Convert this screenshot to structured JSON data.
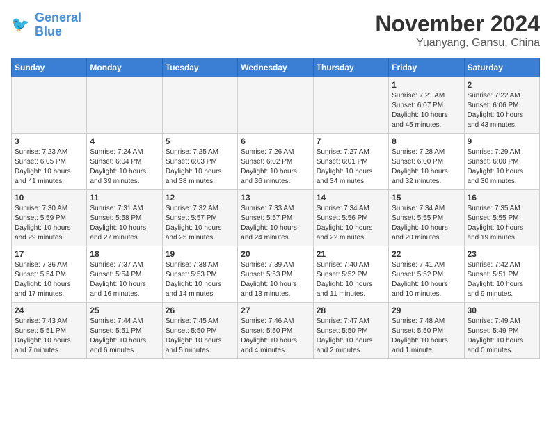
{
  "header": {
    "logo_line1": "General",
    "logo_line2": "Blue",
    "title": "November 2024",
    "subtitle": "Yuanyang, Gansu, China"
  },
  "weekdays": [
    "Sunday",
    "Monday",
    "Tuesday",
    "Wednesday",
    "Thursday",
    "Friday",
    "Saturday"
  ],
  "weeks": [
    [
      {
        "day": "",
        "info": ""
      },
      {
        "day": "",
        "info": ""
      },
      {
        "day": "",
        "info": ""
      },
      {
        "day": "",
        "info": ""
      },
      {
        "day": "",
        "info": ""
      },
      {
        "day": "1",
        "info": "Sunrise: 7:21 AM\nSunset: 6:07 PM\nDaylight: 10 hours\nand 45 minutes."
      },
      {
        "day": "2",
        "info": "Sunrise: 7:22 AM\nSunset: 6:06 PM\nDaylight: 10 hours\nand 43 minutes."
      }
    ],
    [
      {
        "day": "3",
        "info": "Sunrise: 7:23 AM\nSunset: 6:05 PM\nDaylight: 10 hours\nand 41 minutes."
      },
      {
        "day": "4",
        "info": "Sunrise: 7:24 AM\nSunset: 6:04 PM\nDaylight: 10 hours\nand 39 minutes."
      },
      {
        "day": "5",
        "info": "Sunrise: 7:25 AM\nSunset: 6:03 PM\nDaylight: 10 hours\nand 38 minutes."
      },
      {
        "day": "6",
        "info": "Sunrise: 7:26 AM\nSunset: 6:02 PM\nDaylight: 10 hours\nand 36 minutes."
      },
      {
        "day": "7",
        "info": "Sunrise: 7:27 AM\nSunset: 6:01 PM\nDaylight: 10 hours\nand 34 minutes."
      },
      {
        "day": "8",
        "info": "Sunrise: 7:28 AM\nSunset: 6:00 PM\nDaylight: 10 hours\nand 32 minutes."
      },
      {
        "day": "9",
        "info": "Sunrise: 7:29 AM\nSunset: 6:00 PM\nDaylight: 10 hours\nand 30 minutes."
      }
    ],
    [
      {
        "day": "10",
        "info": "Sunrise: 7:30 AM\nSunset: 5:59 PM\nDaylight: 10 hours\nand 29 minutes."
      },
      {
        "day": "11",
        "info": "Sunrise: 7:31 AM\nSunset: 5:58 PM\nDaylight: 10 hours\nand 27 minutes."
      },
      {
        "day": "12",
        "info": "Sunrise: 7:32 AM\nSunset: 5:57 PM\nDaylight: 10 hours\nand 25 minutes."
      },
      {
        "day": "13",
        "info": "Sunrise: 7:33 AM\nSunset: 5:57 PM\nDaylight: 10 hours\nand 24 minutes."
      },
      {
        "day": "14",
        "info": "Sunrise: 7:34 AM\nSunset: 5:56 PM\nDaylight: 10 hours\nand 22 minutes."
      },
      {
        "day": "15",
        "info": "Sunrise: 7:34 AM\nSunset: 5:55 PM\nDaylight: 10 hours\nand 20 minutes."
      },
      {
        "day": "16",
        "info": "Sunrise: 7:35 AM\nSunset: 5:55 PM\nDaylight: 10 hours\nand 19 minutes."
      }
    ],
    [
      {
        "day": "17",
        "info": "Sunrise: 7:36 AM\nSunset: 5:54 PM\nDaylight: 10 hours\nand 17 minutes."
      },
      {
        "day": "18",
        "info": "Sunrise: 7:37 AM\nSunset: 5:54 PM\nDaylight: 10 hours\nand 16 minutes."
      },
      {
        "day": "19",
        "info": "Sunrise: 7:38 AM\nSunset: 5:53 PM\nDaylight: 10 hours\nand 14 minutes."
      },
      {
        "day": "20",
        "info": "Sunrise: 7:39 AM\nSunset: 5:53 PM\nDaylight: 10 hours\nand 13 minutes."
      },
      {
        "day": "21",
        "info": "Sunrise: 7:40 AM\nSunset: 5:52 PM\nDaylight: 10 hours\nand 11 minutes."
      },
      {
        "day": "22",
        "info": "Sunrise: 7:41 AM\nSunset: 5:52 PM\nDaylight: 10 hours\nand 10 minutes."
      },
      {
        "day": "23",
        "info": "Sunrise: 7:42 AM\nSunset: 5:51 PM\nDaylight: 10 hours\nand 9 minutes."
      }
    ],
    [
      {
        "day": "24",
        "info": "Sunrise: 7:43 AM\nSunset: 5:51 PM\nDaylight: 10 hours\nand 7 minutes."
      },
      {
        "day": "25",
        "info": "Sunrise: 7:44 AM\nSunset: 5:51 PM\nDaylight: 10 hours\nand 6 minutes."
      },
      {
        "day": "26",
        "info": "Sunrise: 7:45 AM\nSunset: 5:50 PM\nDaylight: 10 hours\nand 5 minutes."
      },
      {
        "day": "27",
        "info": "Sunrise: 7:46 AM\nSunset: 5:50 PM\nDaylight: 10 hours\nand 4 minutes."
      },
      {
        "day": "28",
        "info": "Sunrise: 7:47 AM\nSunset: 5:50 PM\nDaylight: 10 hours\nand 2 minutes."
      },
      {
        "day": "29",
        "info": "Sunrise: 7:48 AM\nSunset: 5:50 PM\nDaylight: 10 hours\nand 1 minute."
      },
      {
        "day": "30",
        "info": "Sunrise: 7:49 AM\nSunset: 5:49 PM\nDaylight: 10 hours\nand 0 minutes."
      }
    ]
  ]
}
